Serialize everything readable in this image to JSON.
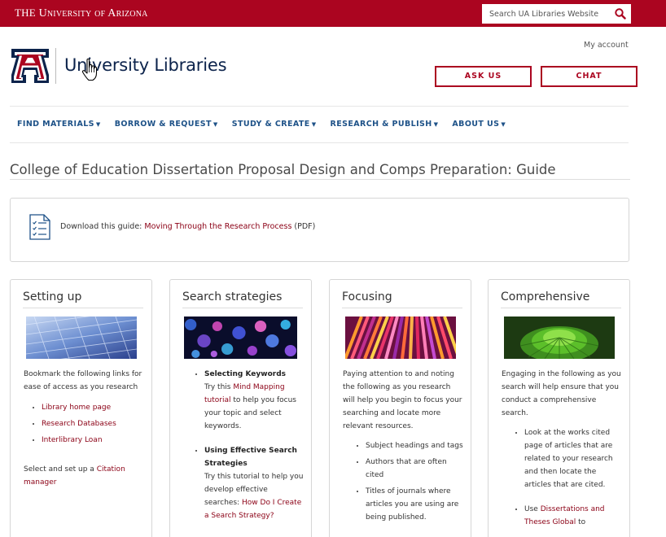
{
  "topbar": {
    "university_the": "The",
    "university_name": "University of Arizona",
    "search_placeholder": "Search UA Libraries Website"
  },
  "header": {
    "libraries_title": "University Libraries",
    "my_account": "My account",
    "ask_us": "ASK US",
    "chat": "CHAT"
  },
  "nav": [
    {
      "label": "FIND MATERIALS"
    },
    {
      "label": "BORROW & REQUEST"
    },
    {
      "label": "STUDY & CREATE"
    },
    {
      "label": "RESEARCH & PUBLISH"
    },
    {
      "label": "ABOUT US"
    }
  ],
  "page": {
    "title": "College of Education Dissertation Proposal Design and Comps Preparation: Guide"
  },
  "download": {
    "prefix": "Download this guide: ",
    "link": "Moving Through the Research Process",
    "suffix": " (PDF)"
  },
  "cards": {
    "setting_up": {
      "title": "Setting up",
      "intro": "Bookmark the following links for ease of access as you research",
      "links": [
        "Library home page",
        "Research Databases",
        "Interlibrary Loan"
      ],
      "outro_prefix": "Select and set up a ",
      "outro_link": "Citation manager"
    },
    "search": {
      "title": "Search strategies",
      "item1_heading": "Selecting Keywords",
      "item1_pre": "Try this ",
      "item1_link": "Mind Mapping tutorial",
      "item1_post": " to help you focus your topic and select keywords.",
      "item2_heading": "Using Effective Search Strategies",
      "item2_pre": "Try this tutorial to help you develop effective searches: ",
      "item2_link": "How Do I Create a Search Strategy?"
    },
    "focusing": {
      "title": "Focusing",
      "intro": "Paying  attention to and noting the following as you research will help you begin to focus your searching and locate more relevant resources.",
      "items": [
        "Subject headings and tags",
        "Authors that are often cited",
        "Titles of journals where articles you are using are being published."
      ]
    },
    "comprehensive": {
      "title": "Comprehensive",
      "intro": "Engaging in the following as you search will help ensure that you conduct a comprehensive search.",
      "item1": "Look at the works cited page of articles that are related to your research and then locate the articles that are cited.",
      "item2_pre": "Use ",
      "item2_link": "Dissertations and Theses Global",
      "item2_post": " to"
    }
  },
  "colors": {
    "brand_red": "#ab0520",
    "navy": "#0c234b",
    "nav_blue": "#1e5288",
    "link_red": "#8b0015"
  }
}
